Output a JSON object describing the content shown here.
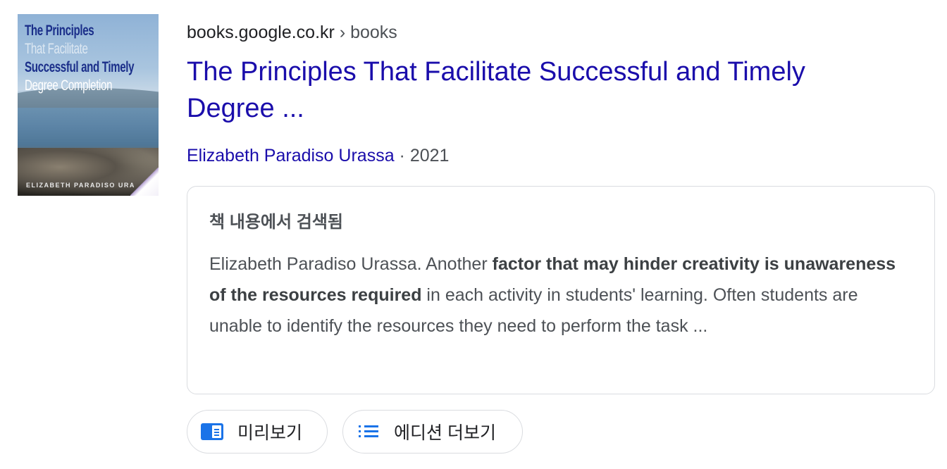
{
  "result": {
    "thumbnail": {
      "cover_lines": [
        "The Principles",
        "That Facilitate",
        "Successful and Timely",
        "Degree Completion"
      ],
      "cover_author": "ELIZABETH PARADISO URA"
    },
    "breadcrumb": {
      "domain": "books.google.co.kr",
      "separator": "›",
      "path": "books"
    },
    "title": "The Principles That Facilitate Successful and Timely Degree ...",
    "author": "Elizabeth Paradiso Urassa",
    "meta_separator": "·",
    "year": "2021",
    "snippet": {
      "heading": "책 내용에서 검색됨",
      "text_before": "Elizabeth Paradiso Urassa. Another ",
      "bold": "factor that may hinder creativity is unawareness of the resources required",
      "text_after": " in each activity in students' learning. Often students are unable to identify the resources they need to perform the task ..."
    },
    "actions": {
      "preview_label": "미리보기",
      "preview_icon": "book-preview-icon",
      "editions_label": "에디션 더보기",
      "editions_icon": "list-icon"
    }
  },
  "colors": {
    "link": "#1a0dab",
    "accent": "#1a73e8",
    "text": "#202124",
    "muted": "#4d5156",
    "border": "#dadce0"
  }
}
